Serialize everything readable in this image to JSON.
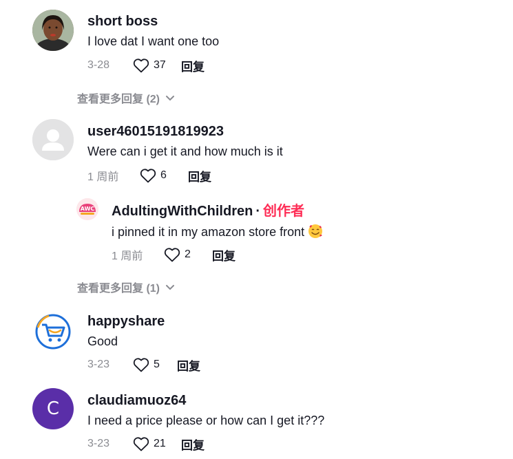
{
  "comments": [
    {
      "username": "short boss",
      "text": "I love dat I want one too",
      "date": "3-28",
      "likes": "37",
      "reply_label": "回复",
      "avatar": "user-photo-avatar"
    },
    {
      "view_more_label": "查看更多回复 (2)"
    },
    {
      "username": "user46015191819923",
      "text": "Were can i get it and how much is it",
      "date": "1 周前",
      "likes": "6",
      "reply_label": "回复",
      "avatar": "default-gray-avatar"
    },
    {
      "username": "AdultingWithChildren",
      "separator": "·",
      "creator_badge": "创作者",
      "text": "i pinned it in my amazon store front",
      "emoji": "smiling-face-with-hearts-emoji",
      "date": "1 周前",
      "likes": "2",
      "reply_label": "回复",
      "avatar": "brand-logo-avatar"
    },
    {
      "view_more_label": "查看更多回复 (1)"
    },
    {
      "username": "happyshare",
      "text": "Good",
      "date": "3-23",
      "likes": "5",
      "reply_label": "回复",
      "avatar": "shopping-cart-avatar"
    },
    {
      "username": "claudiamuoz64",
      "text": "I need a price please or how can I get it???",
      "date": "3-23",
      "likes": "21",
      "reply_label": "回复",
      "avatar": "letter-avatar",
      "avatar_letter": "C"
    }
  ],
  "colors": {
    "text_primary": "#161823",
    "text_secondary": "#8a8b91",
    "creator": "#fe2c55",
    "avatar_purple": "#5a2ea8",
    "avatar_gray": "#e3e3e4",
    "cart_blue": "#1e6fd9",
    "cart_orange": "#f5a623"
  }
}
